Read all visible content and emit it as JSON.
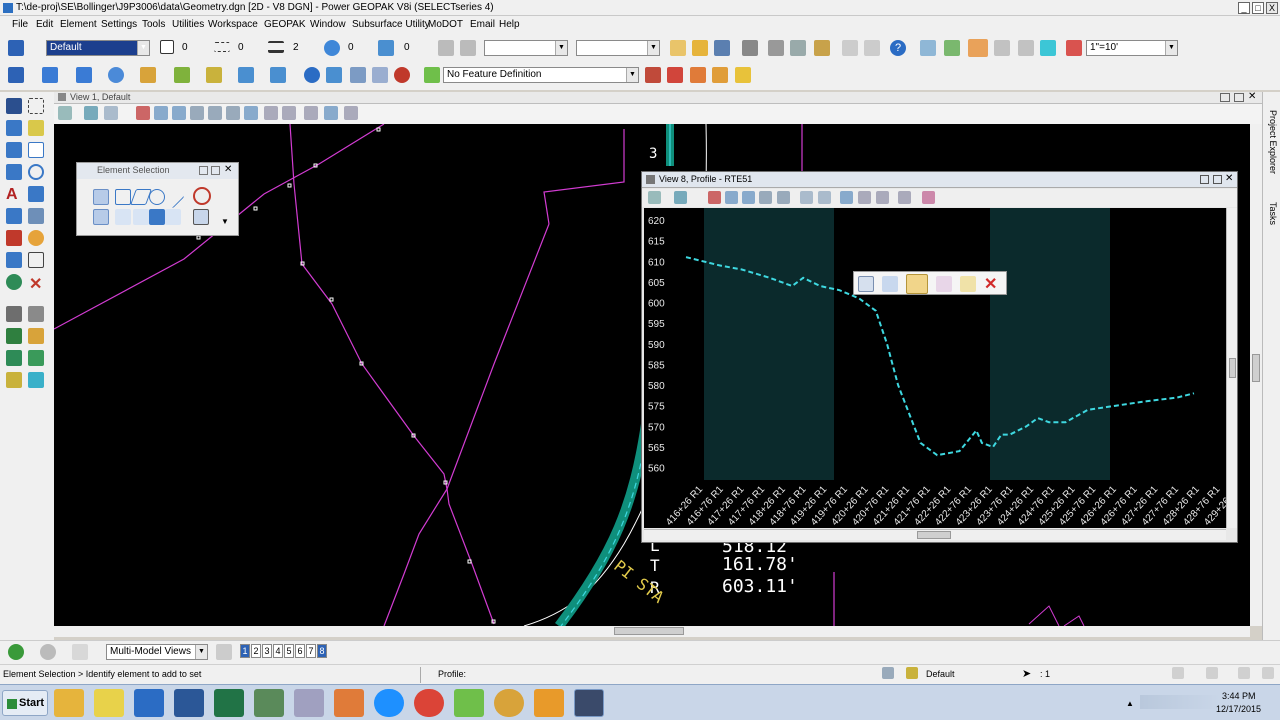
{
  "window": {
    "title": "T:\\de-proj\\SE\\Bollinger\\J9P3006\\data\\Geometry.dgn [2D - V8 DGN] - Power GEOPAK V8i (SELECTseries 4)",
    "min_label": "_",
    "max_label": "□",
    "close_label": "X"
  },
  "menu": [
    "File",
    "Edit",
    "Element",
    "Settings",
    "Tools",
    "Utilities",
    "Workspace",
    "GEOPAK",
    "Window",
    "Subsurface Utility",
    "MoDOT",
    "Email",
    "Help"
  ],
  "toolbar": {
    "level_value": "Default",
    "color_value": "0",
    "style_value": "0",
    "weight_value": "2",
    "transparency_value": "0",
    "priority_value": "0",
    "scale_value": "1\"=10'",
    "feature_definition": "No Feature Definition"
  },
  "view1": {
    "title": "View 1, Default"
  },
  "element_selection": {
    "title": "Element Selection"
  },
  "profile_view": {
    "title": "View 8, Profile - RTE51",
    "y_ticks": [
      "620",
      "615",
      "610",
      "605",
      "600",
      "595",
      "590",
      "585",
      "580",
      "575",
      "570",
      "565",
      "560"
    ],
    "x_ticks": [
      "416+26 R1",
      "416+76 R1",
      "417+26 R1",
      "417+76 R1",
      "418+26 R1",
      "418+76 R1",
      "419+26 R1",
      "419+76 R1",
      "420+26 R1",
      "420+76 R1",
      "421+26 R1",
      "421+76 R1",
      "422+26 R1",
      "422+76 R1",
      "423+26 R1",
      "423+76 R1",
      "424+26 R1",
      "424+76 R1",
      "425+26 R1",
      "425+76 R1",
      "426+26 R1",
      "426+76 R1",
      "427+26 R1",
      "427+76 R1",
      "428+26 R1",
      "428+76 R1",
      "429+26 R1"
    ]
  },
  "canvas_text": {
    "line1": "518.12",
    "t_label": "T",
    "t_value": "161.78'",
    "r_label": "R",
    "r_value": "603.11'",
    "l_label": "L",
    "station_text": "PI STA",
    "number_3": "3"
  },
  "bottom": {
    "views_combo": "Multi-Model Views",
    "view_numbers": [
      "1",
      "2",
      "3",
      "4",
      "5",
      "6",
      "7",
      "8"
    ]
  },
  "status": {
    "left": "Element Selection > Identify element to add to set",
    "profile": "Profile:",
    "level": "Default",
    "count": ": 1"
  },
  "taskbar": {
    "start": "Start",
    "time": "3:44 PM",
    "date": "12/17/2015"
  },
  "right_panel": {
    "tab1": "Project Explorer",
    "tab2": "Tasks"
  },
  "colors": {
    "canvas": "#000000",
    "magenta": "#d23cd2",
    "cyan": "#3ed8e0",
    "teal": "#0f8f7c",
    "green_band": "#0a2a2a"
  }
}
